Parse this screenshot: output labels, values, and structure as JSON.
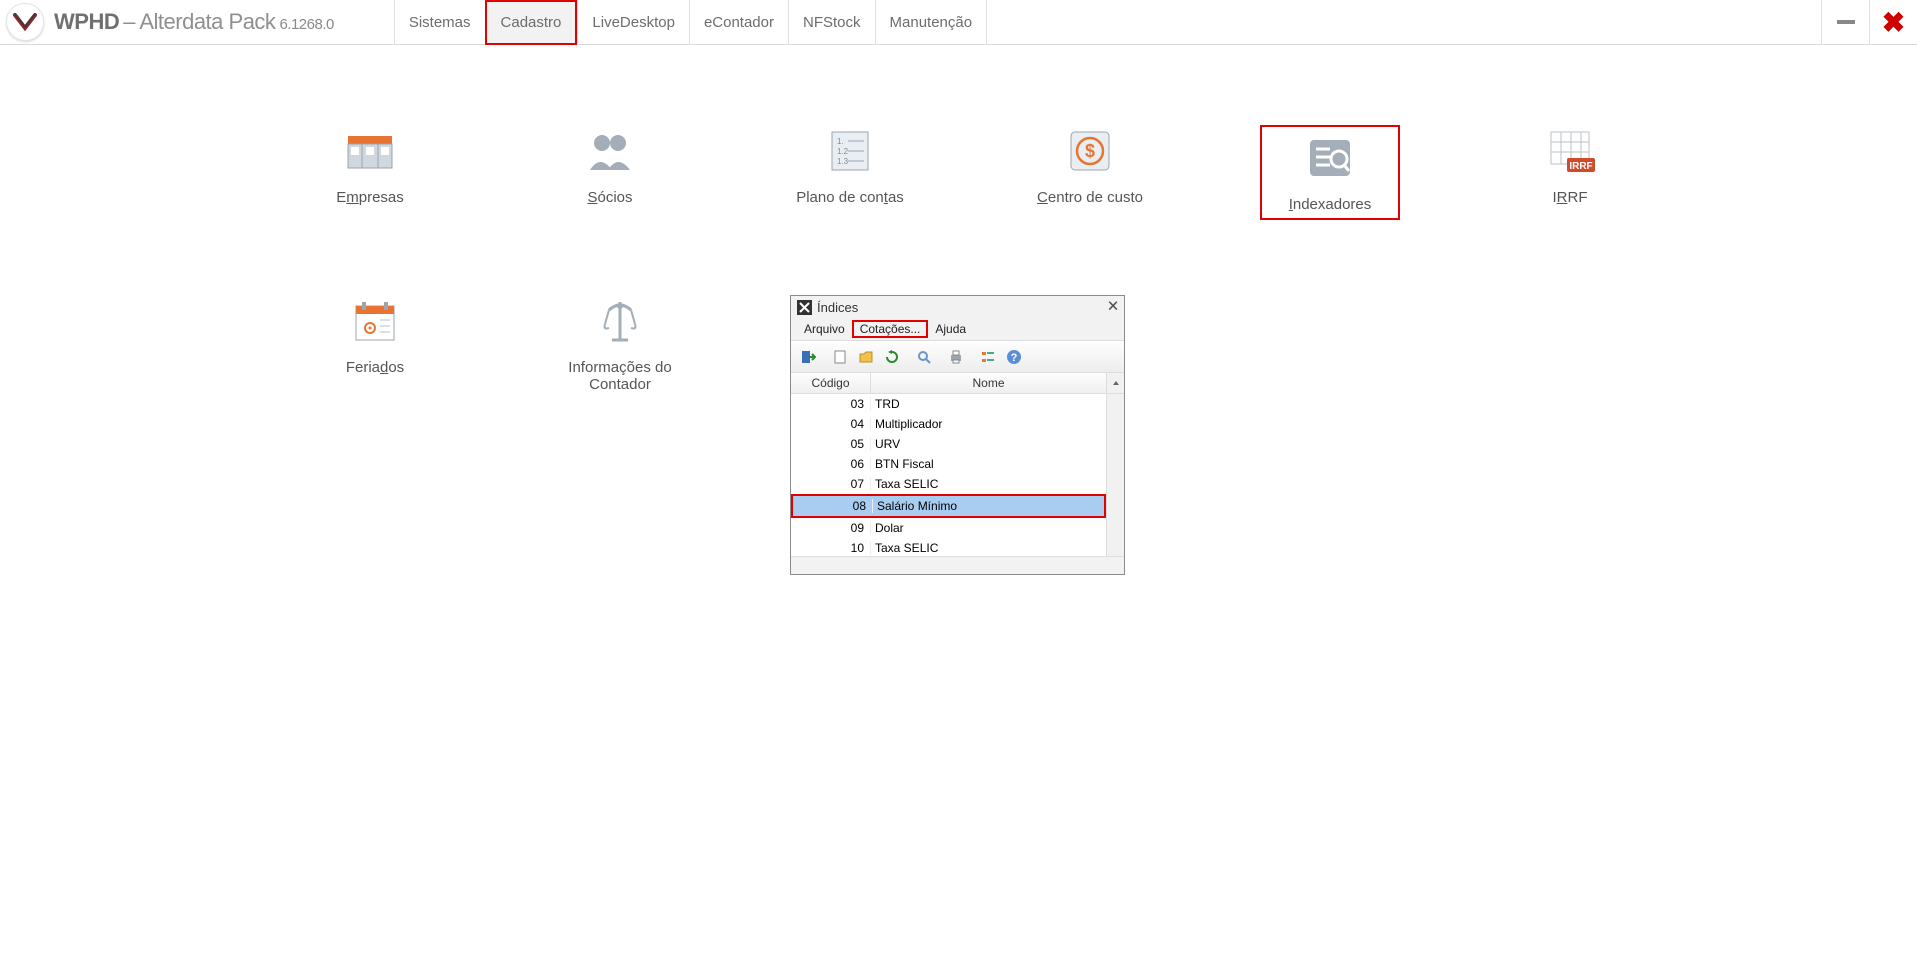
{
  "app": {
    "title_bold": "WPHD",
    "title_rest": "– Alterdata Pack",
    "version": "6.1268.0"
  },
  "menu": {
    "items": [
      {
        "label": "Sistemas"
      },
      {
        "label": "Cadastro",
        "active": true,
        "highlighted": true
      },
      {
        "label": "LiveDesktop"
      },
      {
        "label": "eContador"
      },
      {
        "label": "NFStock"
      },
      {
        "label": "Manutenção"
      }
    ]
  },
  "icons_row1": [
    {
      "label_pre": "E",
      "label_u": "m",
      "label_post": "presas",
      "name": "empresas"
    },
    {
      "label_pre": "",
      "label_u": "S",
      "label_post": "ócios",
      "name": "socios"
    },
    {
      "label_pre": "Plano de con",
      "label_u": "t",
      "label_post": "as",
      "name": "plano-de-contas"
    },
    {
      "label_pre": "",
      "label_u": "C",
      "label_post": "entro de custo",
      "name": "centro-de-custo"
    },
    {
      "label_pre": "",
      "label_u": "I",
      "label_post": "ndexadores",
      "name": "indexadores",
      "highlighted": true
    },
    {
      "label_pre": "I",
      "label_u": "R",
      "label_post": "RF",
      "name": "irrf"
    }
  ],
  "icons_row2": [
    {
      "label_pre": "Feria",
      "label_u": "d",
      "label_post": "os",
      "name": "feriados"
    },
    {
      "label_multi1": "Informações do",
      "label_multi2": "Contador",
      "name": "informacoes-do-contador"
    }
  ],
  "dialog": {
    "title": "Índices",
    "menu": [
      {
        "label": "Arquivo"
      },
      {
        "label": "Cotações...",
        "highlighted": true
      },
      {
        "label": "Ajuda"
      }
    ],
    "columns": {
      "c1": "Código",
      "c2": "Nome"
    },
    "rows": [
      {
        "codigo": "03",
        "nome": "TRD"
      },
      {
        "codigo": "04",
        "nome": "Multiplicador"
      },
      {
        "codigo": "05",
        "nome": "URV"
      },
      {
        "codigo": "06",
        "nome": "BTN Fiscal"
      },
      {
        "codigo": "07",
        "nome": "Taxa SELIC"
      },
      {
        "codigo": "08",
        "nome": "Salário Mínimo",
        "selected": true
      },
      {
        "codigo": "09",
        "nome": "Dolar"
      },
      {
        "codigo": "10",
        "nome": "Taxa SELIC"
      }
    ]
  }
}
